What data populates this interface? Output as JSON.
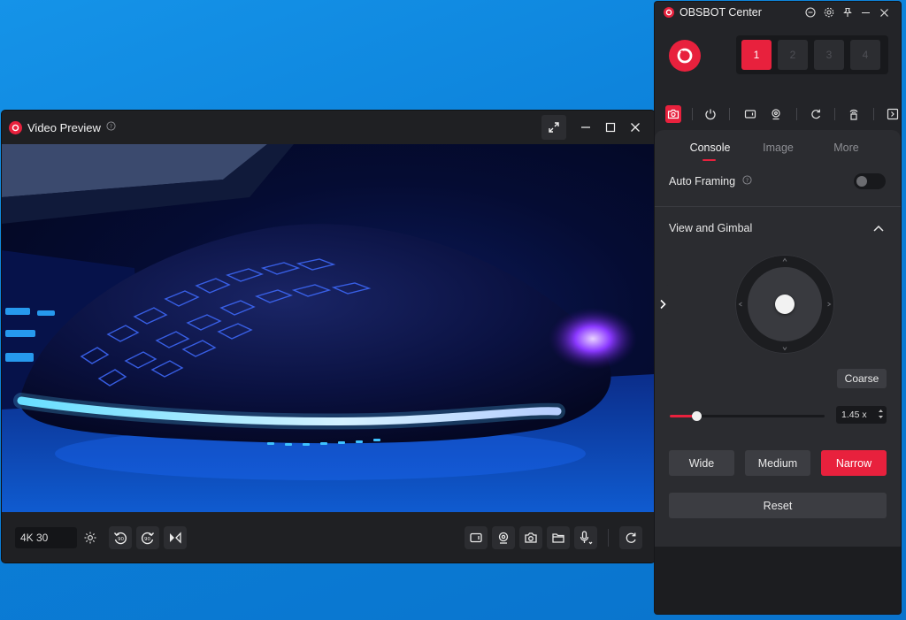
{
  "video_preview": {
    "title": "Video Preview",
    "resolution": "4K 30",
    "toolbar_icons": [
      "settings-gear-icon",
      "rotate-left-90-icon",
      "rotate-right-90-icon",
      "flip-mirror-icon"
    ],
    "right_tool_icons": [
      "record-video-icon",
      "webcam-icon",
      "camera-snapshot-icon",
      "folder-icon",
      "microphone-icon",
      "refresh-icon"
    ],
    "rotate_left_label": "90",
    "rotate_right_label": "90"
  },
  "obsbot_center": {
    "title": "OBSBOT Center",
    "device_slots": [
      "1",
      "2",
      "3",
      "4"
    ],
    "active_slot": "1",
    "tabs": [
      "Console",
      "Image",
      "More"
    ],
    "active_tab": "Console",
    "auto_framing": {
      "label": "Auto Framing",
      "enabled": false
    },
    "view_gimbal": {
      "title": "View and Gimbal"
    },
    "coarse_label": "Coarse",
    "zoom": {
      "value": "1.45 x",
      "fraction": 0.17
    },
    "presets": [
      "Wide",
      "Medium",
      "Narrow"
    ],
    "active_preset": "Narrow",
    "reset_label": "Reset"
  },
  "colors": {
    "accent": "#e8213d",
    "panel_bg": "#232428",
    "desktop_blue": "#0b7fd8"
  }
}
